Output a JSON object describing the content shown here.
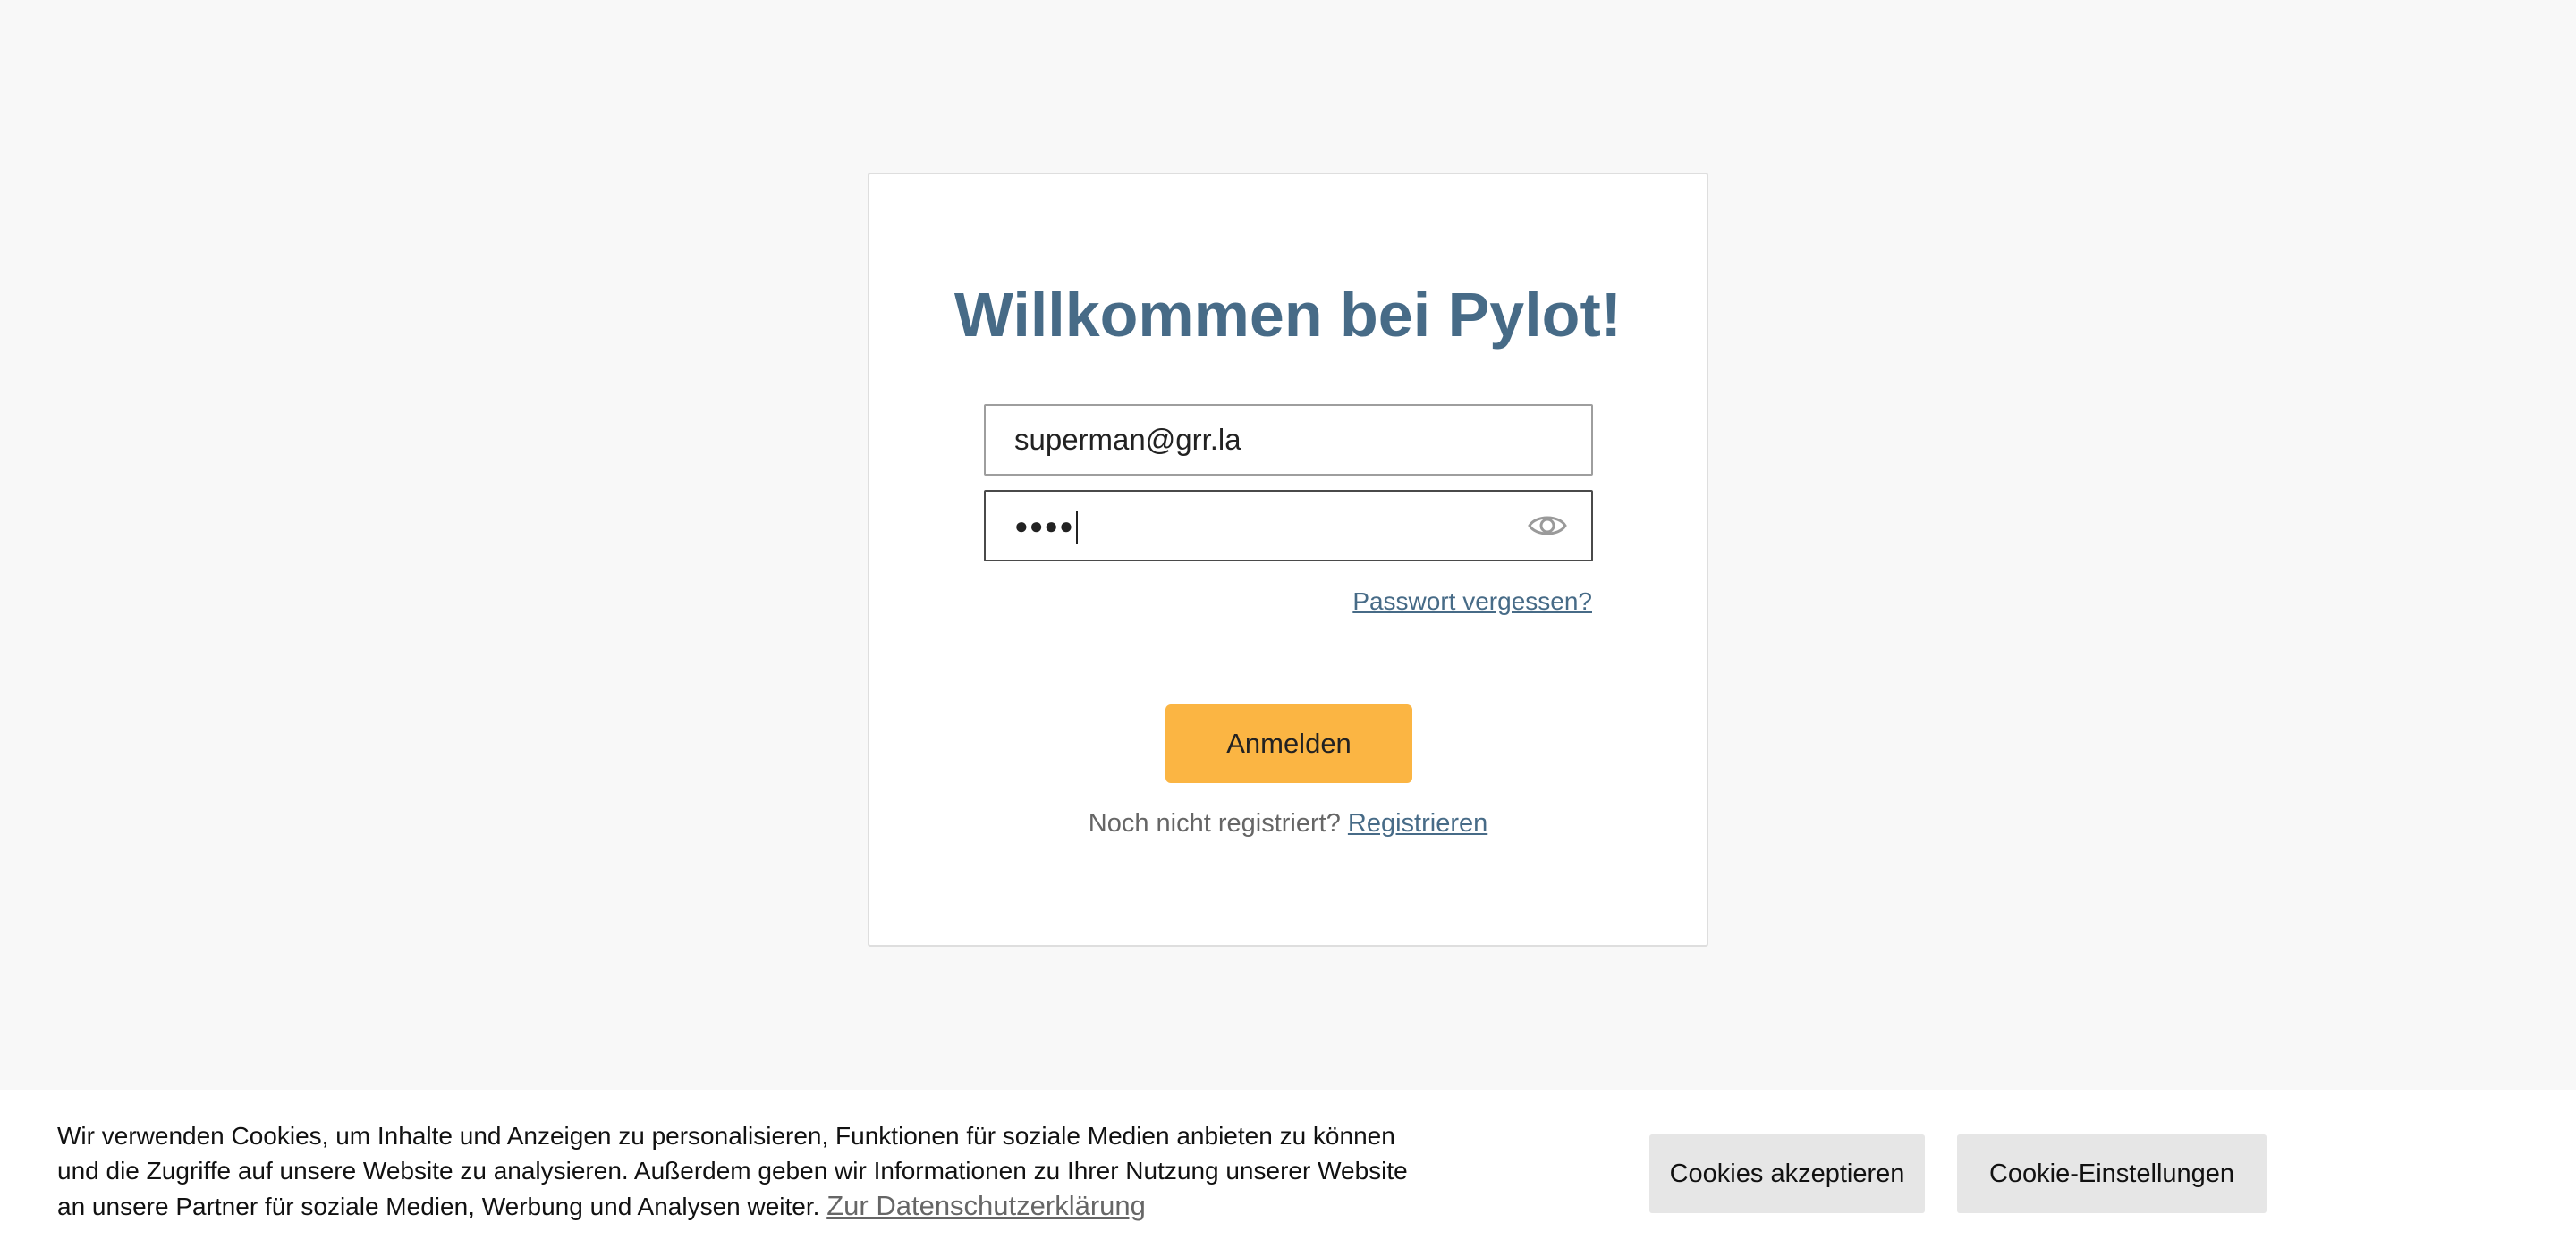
{
  "login": {
    "title": "Willkommen bei Pylot!",
    "email_value": "superman@grr.la",
    "password_value": "●●●●",
    "forgot_password": "Passwort vergessen?",
    "submit_label": "Anmelden",
    "register_prompt": "Noch nicht registriert?",
    "register_link": "Registrieren"
  },
  "cookie_banner": {
    "text": "Wir verwenden Cookies, um Inhalte und Anzeigen zu personalisieren, Funktionen für soziale Medien anbieten zu können und die Zugriffe auf unsere Website zu analysieren. Außerdem geben wir Informationen zu Ihrer Nutzung unserer Website an unsere Partner für soziale Medien, Werbung und Analysen weiter.",
    "privacy_link": "Zur Datenschutzerklärung",
    "accept_label": "Cookies akzeptieren",
    "settings_label": "Cookie-Einstellungen"
  },
  "icons": {
    "password_toggle": "eye-icon"
  },
  "colors": {
    "accent": "#476b87",
    "button": "#fbb543",
    "background": "#f8f8f8"
  }
}
